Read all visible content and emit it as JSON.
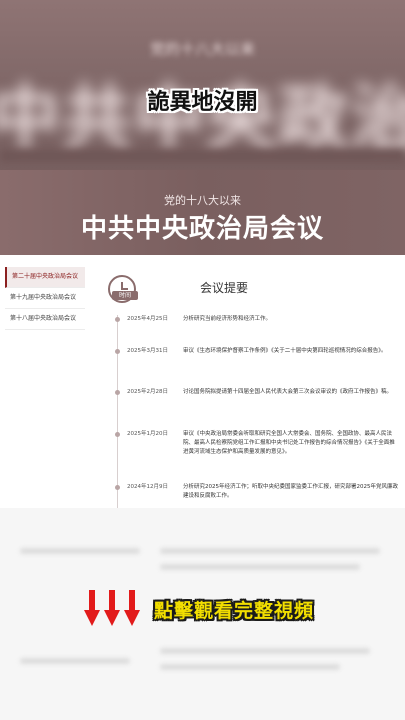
{
  "top": {
    "blurred_subtitle": "党的十八大以来",
    "blurred_title": "中共中央政治局会议",
    "overlay_caption": "詭異地沒開"
  },
  "banner": {
    "subtitle": "党的十八大以来",
    "title": "中共中央政治局会议"
  },
  "sidebar": {
    "items": [
      {
        "label": "第二十届中央政治局会议",
        "active": true
      },
      {
        "label": "第十九届中央政治局会议",
        "active": false
      },
      {
        "label": "第十八届中央政治局会议",
        "active": false
      }
    ]
  },
  "section": {
    "icon_label": "时间",
    "title": "会议提要"
  },
  "entries": [
    {
      "date": "2025年4月25日",
      "text": "分析研究当前经济形势和经济工作。"
    },
    {
      "date": "2025年3月31日",
      "text": "审议《生态环境保护督察工作条例》《关于二十届中央第四轮巡视情况的综合报告》。"
    },
    {
      "date": "2025年2月28日",
      "text": "讨论国务院拟提请第十四届全国人民代表大会第三次会议审议的《政府工作报告》稿。"
    },
    {
      "date": "2025年1月20日",
      "text": "审议《中央政治局常委会听取和研究全国人大常委会、国务院、全国政协、最高人民法院、最高人民检察院党组工作汇报和中央书记处工作报告的综合情况报告》《关于全面推进黄河流域生态保护和高质量发展的意见》。"
    },
    {
      "date": "2024年12月9日",
      "text": "分析研究2025年经济工作；听取中央纪委国家监委工作汇报，研究部署2025年党风廉政建设和反腐败工作。"
    }
  ],
  "bottom": {
    "caption": "點擊觀看完整視頻"
  },
  "colors": {
    "banner": "#7f6464",
    "accent": "#8b2020",
    "arrow": "#e21b1b",
    "caption_yellow": "#f2de00"
  }
}
